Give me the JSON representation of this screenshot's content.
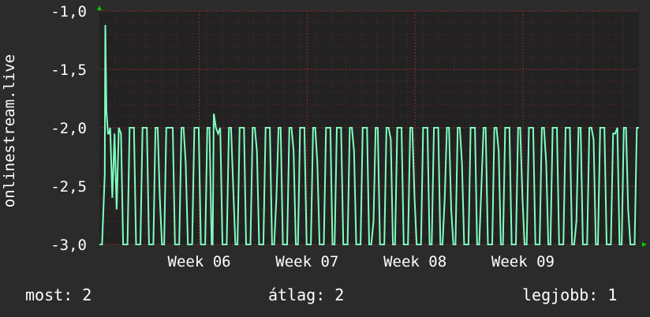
{
  "colors": {
    "background": "#2b2b2b",
    "plot_background": "#222222",
    "grid": "#7a2a2a",
    "line": "#7fffc0",
    "axis_arrow": "#00cc00",
    "text": "#ffffff"
  },
  "footer": {
    "most_label": "most:",
    "most_value": "2",
    "atlag_label": "átlag:",
    "atlag_value": "2",
    "legjobb_label": "legjobb:",
    "legjobb_value": "1"
  },
  "chart_data": {
    "type": "line",
    "title": "",
    "ylabel": "onlinestream.live",
    "xlabel": "",
    "ylim": [
      -3.0,
      -1.0
    ],
    "yticks": [
      -1.0,
      -1.5,
      -2.0,
      -2.5,
      -3.0
    ],
    "ytick_labels": [
      "-1,0",
      "-1,5",
      "-2,0",
      "-2,5",
      "-3,0"
    ],
    "xlim": [
      0,
      100
    ],
    "xticks": [
      {
        "x": 18.5,
        "label": "Week 06"
      },
      {
        "x": 38.5,
        "label": "Week 07"
      },
      {
        "x": 58.5,
        "label": "Week 08"
      },
      {
        "x": 78.5,
        "label": "Week 09"
      }
    ],
    "grid": true,
    "series": [
      {
        "name": "",
        "x": [
          0,
          0.5,
          1,
          1.1,
          1.3,
          1.6,
          1.8,
          2,
          2.4,
          2.8,
          3.2,
          3.6,
          4,
          4.4,
          4.8,
          5.2,
          5.6,
          6,
          6.4,
          6.8,
          7.2,
          7.6,
          8,
          8.4,
          8.8,
          9.2,
          9.6,
          10,
          10.4,
          10.8,
          11.2,
          11.6,
          12,
          12.4,
          12.8,
          13.2,
          13.6,
          14,
          14.4,
          14.8,
          15.2,
          15.6,
          16,
          16.4,
          16.8,
          17.2,
          17.6,
          18,
          18.4,
          18.8,
          19.2,
          19.6,
          20,
          20.4,
          20.8,
          21,
          21.2,
          21.6,
          22,
          22.4,
          22.8,
          23.2,
          23.6,
          24,
          24.4,
          24.8,
          25.2,
          25.6,
          26,
          26.4,
          26.8,
          27.2,
          27.6,
          28,
          28.4,
          28.8,
          29.2,
          29.6,
          30,
          30.4,
          30.8,
          31.2,
          31.6,
          32,
          32.4,
          32.8,
          33.2,
          33.6,
          34,
          34.4,
          34.8,
          35.2,
          35.6,
          36,
          36.4,
          36.8,
          37.2,
          37.6,
          38,
          38.4,
          38.8,
          39.2,
          39.6,
          40,
          40.4,
          40.8,
          41.2,
          41.6,
          42,
          42.4,
          42.8,
          43.2,
          43.6,
          44,
          44.4,
          44.8,
          45.2,
          45.6,
          46,
          46.4,
          46.8,
          47.2,
          47.6,
          48,
          48.4,
          48.8,
          49.2,
          49.6,
          50,
          50.4,
          50.8,
          51.2,
          51.6,
          52,
          52.4,
          52.8,
          53.2,
          53.6,
          54,
          54.4,
          54.8,
          55.2,
          55.6,
          56,
          56.4,
          56.8,
          57.2,
          57.6,
          58,
          58.4,
          58.8,
          59.2,
          59.6,
          60,
          60.4,
          60.8,
          61.2,
          61.6,
          62,
          62.4,
          62.8,
          63.2,
          63.6,
          64,
          64.4,
          64.8,
          65.2,
          65.6,
          66,
          66.4,
          66.8,
          67.2,
          67.6,
          68,
          68.4,
          68.8,
          69.2,
          69.6,
          70,
          70.4,
          70.8,
          71.2,
          71.6,
          72,
          72.4,
          72.8,
          73.2,
          73.6,
          74,
          74.4,
          74.8,
          75.2,
          75.6,
          76,
          76.4,
          76.8,
          77.2,
          77.6,
          78,
          78.4,
          78.8,
          79.2,
          79.6,
          80,
          80.4,
          80.8,
          81.2,
          81.6,
          82,
          82.4,
          82.8,
          83.2,
          83.6,
          84,
          84.4,
          84.8,
          85.2,
          85.6,
          86,
          86.4,
          86.8,
          87.2,
          87.6,
          88,
          88.4,
          88.8,
          89.2,
          89.6,
          90,
          90.4,
          90.8,
          91.2,
          91.6,
          92,
          92.4,
          92.8,
          93.2,
          93.6,
          94,
          94.4,
          94.8,
          95.2,
          95.6,
          96,
          96.4,
          96.8,
          97.2,
          97.6,
          98,
          98.4,
          98.8,
          99.2,
          99.6,
          100
        ],
        "values": [
          -3.0,
          -3.0,
          -2.4,
          -1.12,
          -1.85,
          -2.05,
          -2.05,
          -2.0,
          -2.6,
          -2.05,
          -2.7,
          -2.0,
          -2.05,
          -3.0,
          -3.0,
          -3.0,
          -2.0,
          -2.0,
          -2.0,
          -3.0,
          -3.0,
          -3.0,
          -2.0,
          -2.0,
          -2.0,
          -3.0,
          -3.0,
          -3.0,
          -2.0,
          -2.0,
          -2.6,
          -3.0,
          -3.0,
          -2.0,
          -2.0,
          -2.0,
          -2.0,
          -3.0,
          -3.0,
          -3.0,
          -2.0,
          -2.0,
          -2.3,
          -3.0,
          -3.0,
          -3.0,
          -2.0,
          -2.0,
          -2.0,
          -3.0,
          -3.0,
          -3.0,
          -2.0,
          -2.0,
          -3.0,
          -3.0,
          -1.88,
          -2.0,
          -2.05,
          -2.0,
          -3.0,
          -3.0,
          -3.0,
          -2.0,
          -2.0,
          -2.5,
          -3.0,
          -3.0,
          -2.0,
          -2.0,
          -2.0,
          -3.0,
          -3.0,
          -3.0,
          -2.0,
          -2.0,
          -2.2,
          -3.0,
          -3.0,
          -3.0,
          -2.0,
          -2.0,
          -2.0,
          -3.0,
          -3.0,
          -2.6,
          -2.0,
          -2.0,
          -3.0,
          -3.0,
          -3.0,
          -2.0,
          -2.0,
          -2.2,
          -3.0,
          -3.0,
          -2.0,
          -2.0,
          -2.0,
          -3.0,
          -3.0,
          -3.0,
          -2.0,
          -2.0,
          -2.3,
          -3.0,
          -3.0,
          -3.0,
          -2.0,
          -2.0,
          -2.0,
          -3.0,
          -3.0,
          -2.0,
          -2.0,
          -2.0,
          -3.0,
          -3.0,
          -3.0,
          -2.0,
          -2.0,
          -2.2,
          -3.0,
          -3.0,
          -3.0,
          -2.0,
          -2.0,
          -2.0,
          -3.0,
          -3.0,
          -2.8,
          -2.0,
          -2.0,
          -3.0,
          -3.0,
          -3.0,
          -2.0,
          -2.0,
          -2.1,
          -3.0,
          -3.0,
          -2.0,
          -2.0,
          -2.0,
          -3.0,
          -3.0,
          -3.0,
          -2.0,
          -2.0,
          -2.6,
          -3.0,
          -3.0,
          -3.0,
          -2.0,
          -2.0,
          -2.0,
          -3.0,
          -3.0,
          -2.0,
          -2.0,
          -2.0,
          -3.0,
          -3.0,
          -2.6,
          -2.0,
          -2.0,
          -2.7,
          -3.0,
          -3.0,
          -2.0,
          -2.0,
          -2.3,
          -3.0,
          -3.0,
          -3.0,
          -2.0,
          -2.0,
          -2.0,
          -3.0,
          -3.0,
          -2.5,
          -2.0,
          -2.0,
          -3.0,
          -3.0,
          -3.0,
          -2.0,
          -2.0,
          -2.2,
          -3.0,
          -3.0,
          -2.0,
          -2.0,
          -2.0,
          -3.0,
          -3.0,
          -3.0,
          -2.0,
          -2.0,
          -2.6,
          -3.0,
          -3.0,
          -2.0,
          -2.0,
          -2.0,
          -3.0,
          -3.0,
          -3.0,
          -2.0,
          -2.0,
          -2.3,
          -3.0,
          -3.0,
          -2.0,
          -2.0,
          -2.0,
          -3.0,
          -3.0,
          -3.0,
          -2.0,
          -2.0,
          -2.0,
          -3.0,
          -3.0,
          -2.8,
          -2.0,
          -2.0,
          -3.0,
          -3.0,
          -3.0,
          -2.0,
          -2.0,
          -2.1,
          -3.0,
          -3.0,
          -2.0,
          -2.0,
          -2.0,
          -3.0,
          -3.0,
          -3.0,
          -2.05,
          -2.05,
          -2.0,
          -3.0,
          -3.0,
          -2.0,
          -2.0,
          -2.7,
          -3.0,
          -3.0,
          -3.0,
          -2.0,
          -2.0
        ]
      }
    ]
  }
}
